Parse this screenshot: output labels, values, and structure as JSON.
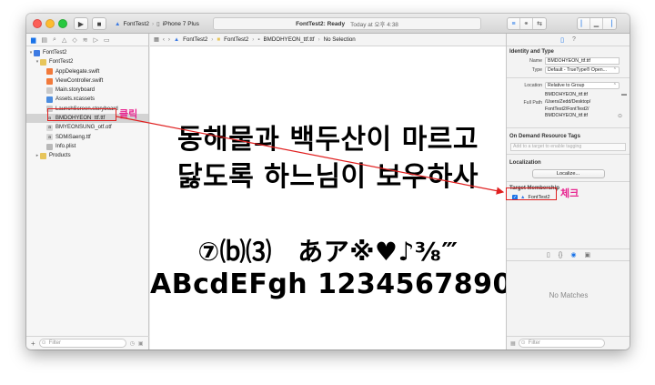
{
  "toolbar": {
    "scheme_target": "FontTest2",
    "scheme_device": "iPhone 7 Plus",
    "status_title": "FontTest2: Ready",
    "status_time": "Today at 오후 4:38"
  },
  "navigator": {
    "filter_placeholder": "Filter",
    "items": [
      {
        "label": "FontTest2",
        "kind": "project"
      },
      {
        "label": "FontTest2",
        "kind": "folder"
      },
      {
        "label": "AppDelegate.swift",
        "kind": "swift"
      },
      {
        "label": "ViewController.swift",
        "kind": "swift"
      },
      {
        "label": "Main.storyboard",
        "kind": "storyboard"
      },
      {
        "label": "Assets.xcassets",
        "kind": "assets"
      },
      {
        "label": "LaunchScreen.storyboard",
        "kind": "storyboard"
      },
      {
        "label": "BMDOHYEON_ttf.ttf",
        "kind": "font",
        "selected": true
      },
      {
        "label": "BMYEONSUNG_otf.otf",
        "kind": "font"
      },
      {
        "label": "SDMiSaeng.ttf",
        "kind": "font"
      },
      {
        "label": "Info.plist",
        "kind": "plist"
      },
      {
        "label": "Products",
        "kind": "folder"
      }
    ]
  },
  "editor": {
    "breadcrumb": [
      "FontTest2",
      "FontTest2",
      "BMDOHYEON_ttf.ttf",
      "No Selection"
    ],
    "preview_lines": [
      "동해물과 백두산이 마르고",
      "닳도록 하느님이 보우하사",
      "⑦⒝⑶　あア※♥♪⅜‴",
      "ABcdEFgh 1234567890"
    ]
  },
  "inspector": {
    "identity_title": "Identity and Type",
    "name_label": "Name",
    "name_value": "BMDOHYEON_ttf.ttf",
    "type_label": "Type",
    "type_value": "Default - TrueType® Open...",
    "location_label": "Location",
    "location_value": "Relative to Group",
    "location_file": "BMDOHYEON_ttf.ttf",
    "full_path_label": "Full Path",
    "full_path_value": [
      "/Users/Zedd/Desktop/",
      "FontTest2/FontTest2/",
      "BMDOHYEON_ttf.ttf"
    ],
    "odr_title": "On Demand Resource Tags",
    "odr_placeholder": "Add to a target to enable tagging",
    "localization_title": "Localization",
    "localize_button": "Localize...",
    "membership_title": "Target Membership",
    "membership_target": "FontTest2",
    "no_matches": "No Matches",
    "filter_placeholder": "Filter"
  },
  "annotations": {
    "click_label": "클릭",
    "check_label": "체크",
    "color": "#e02020"
  }
}
